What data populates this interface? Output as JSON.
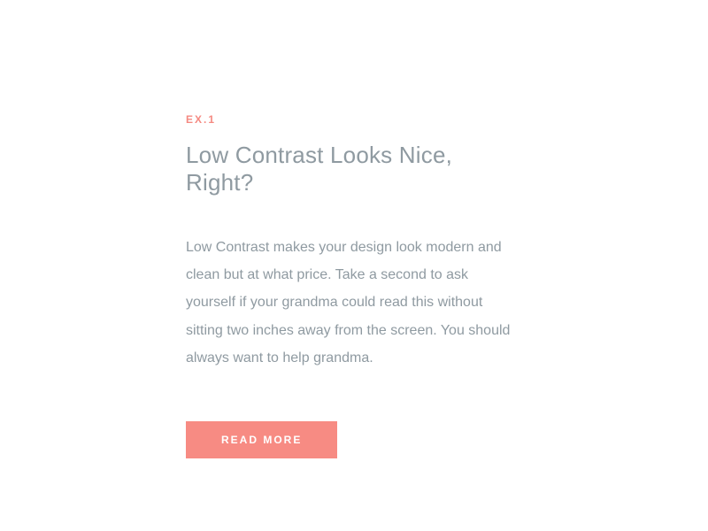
{
  "article": {
    "eyebrow": "EX.1",
    "heading": "Low Contrast Looks Nice, Right?",
    "body": "Low Contrast makes your design look modern and clean but at what price. Take a second to ask yourself if your grandma could read this without sitting two inches away from the screen. You should always want to help grandma.",
    "cta_label": "READ MORE"
  },
  "colors": {
    "accent": "#f78b83",
    "text_muted": "#8f9aa1",
    "background": "#ffffff"
  }
}
